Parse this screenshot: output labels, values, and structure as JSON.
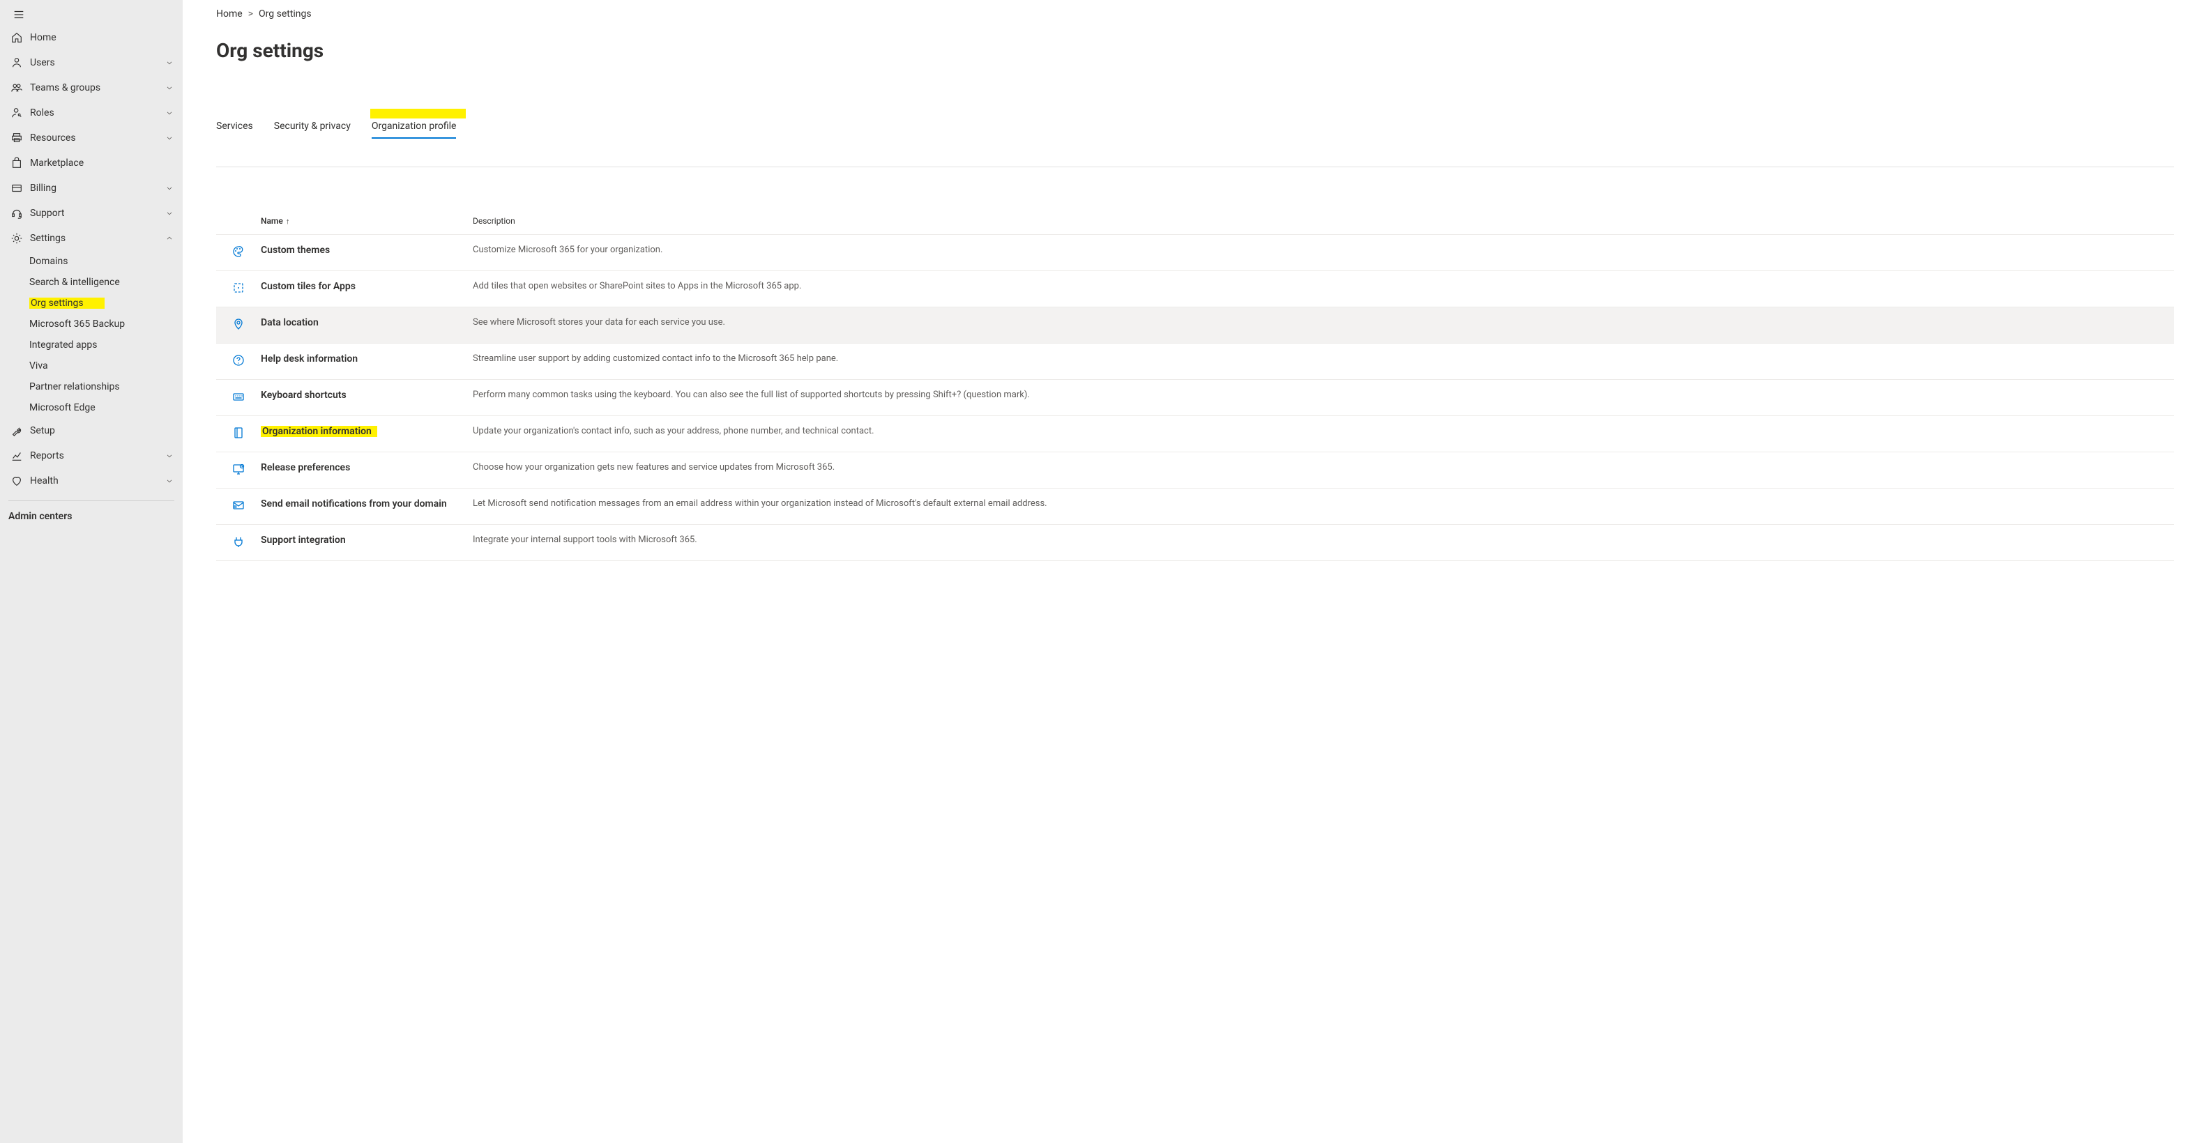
{
  "sidebar": {
    "items": [
      {
        "label": "Home",
        "icon": "home",
        "expandable": false
      },
      {
        "label": "Users",
        "icon": "person",
        "expandable": true
      },
      {
        "label": "Teams & groups",
        "icon": "people",
        "expandable": true
      },
      {
        "label": "Roles",
        "icon": "person-key",
        "expandable": true
      },
      {
        "label": "Resources",
        "icon": "printer",
        "expandable": true
      },
      {
        "label": "Marketplace",
        "icon": "bag",
        "expandable": false
      },
      {
        "label": "Billing",
        "icon": "card",
        "expandable": true
      },
      {
        "label": "Support",
        "icon": "headset",
        "expandable": true
      },
      {
        "label": "Settings",
        "icon": "gear",
        "expandable": true,
        "expanded": true,
        "children": [
          {
            "label": "Domains"
          },
          {
            "label": "Search & intelligence"
          },
          {
            "label": "Org settings",
            "highlight": true
          },
          {
            "label": "Microsoft 365 Backup"
          },
          {
            "label": "Integrated apps"
          },
          {
            "label": "Viva"
          },
          {
            "label": "Partner relationships"
          },
          {
            "label": "Microsoft Edge"
          }
        ]
      },
      {
        "label": "Setup",
        "icon": "wrench",
        "expandable": false
      },
      {
        "label": "Reports",
        "icon": "chart",
        "expandable": true
      },
      {
        "label": "Health",
        "icon": "heart",
        "expandable": true
      }
    ],
    "admin_centers_label": "Admin centers"
  },
  "breadcrumb": {
    "home": "Home",
    "current": "Org settings"
  },
  "page_title": "Org settings",
  "tabs": [
    {
      "label": "Services",
      "active": false
    },
    {
      "label": "Security & privacy",
      "active": false
    },
    {
      "label": "Organization profile",
      "active": true,
      "highlight": true
    }
  ],
  "table": {
    "columns": {
      "name": "Name",
      "description": "Description"
    },
    "rows": [
      {
        "icon": "palette",
        "name": "Custom themes",
        "desc": "Customize Microsoft 365 for your organization."
      },
      {
        "icon": "tile",
        "name": "Custom tiles for Apps",
        "desc": "Add tiles that open websites or SharePoint sites to Apps in the Microsoft 365 app."
      },
      {
        "icon": "location",
        "name": "Data location",
        "desc": "See where Microsoft stores your data for each service you use.",
        "hover": true
      },
      {
        "icon": "question",
        "name": "Help desk information",
        "desc": "Streamline user support by adding customized contact info to the Microsoft 365 help pane."
      },
      {
        "icon": "keyboard",
        "name": "Keyboard shortcuts",
        "desc": "Perform many common tasks using the keyboard. You can also see the full list of supported shortcuts by pressing Shift+? (question mark)."
      },
      {
        "icon": "book",
        "name": "Organization information",
        "desc": "Update your organization's contact info, such as your address, phone number, and technical contact.",
        "highlight": true
      },
      {
        "icon": "monitor",
        "name": "Release preferences",
        "desc": "Choose how your organization gets new features and service updates from Microsoft 365."
      },
      {
        "icon": "mail",
        "name": "Send email notifications from your domain",
        "desc": "Let Microsoft send notification messages from an email address within your organization instead of Microsoft's default external email address."
      },
      {
        "icon": "plug",
        "name": "Support integration",
        "desc": "Integrate your internal support tools with Microsoft 365."
      }
    ]
  }
}
